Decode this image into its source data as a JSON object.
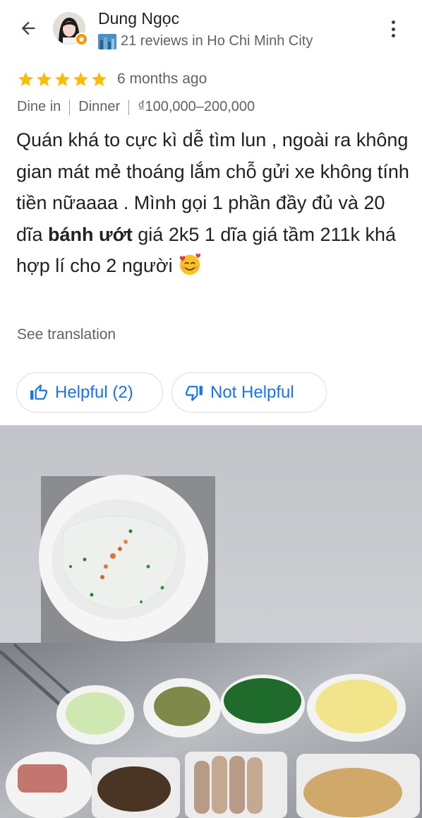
{
  "header": {
    "back_icon": "arrow-back-icon",
    "reviewer_name": "Dung Ngọc",
    "reviewer_subtitle": "21 reviews in Ho Chi Minh City",
    "badge_icon": "local-guide-star-icon",
    "city_icon": "cityscape-icon",
    "menu_icon": "more-vert-icon"
  },
  "rating": {
    "stars": 5,
    "max_stars": 5,
    "time_ago": "6 months ago",
    "star_color": "#fbbc04"
  },
  "meta": {
    "service": "Dine in",
    "meal": "Dinner",
    "price_range": "₫100,000–200,000"
  },
  "review": {
    "text_before_bold": "Quán khá to cực kì dễ tìm lun , ngoài ra không gian mát mẻ thoáng lắm chỗ gửi xe không tính tiền nữaaaa . Mình gọi 1 phần đầy đủ và 20 dĩa ",
    "bold_text": "bánh ướt",
    "text_after_bold": " giá 2k5 1 dĩa giá tầm 211k khá hợp lí cho 2 người ",
    "emoji_icon": "smiling-face-with-hearts-icon"
  },
  "see_translation": "See translation",
  "actions": {
    "helpful_label": "Helpful (2)",
    "not_helpful_label": "Not Helpful",
    "accent_color": "#1a73e8"
  },
  "photo": {
    "description_icon": "food-photo"
  }
}
